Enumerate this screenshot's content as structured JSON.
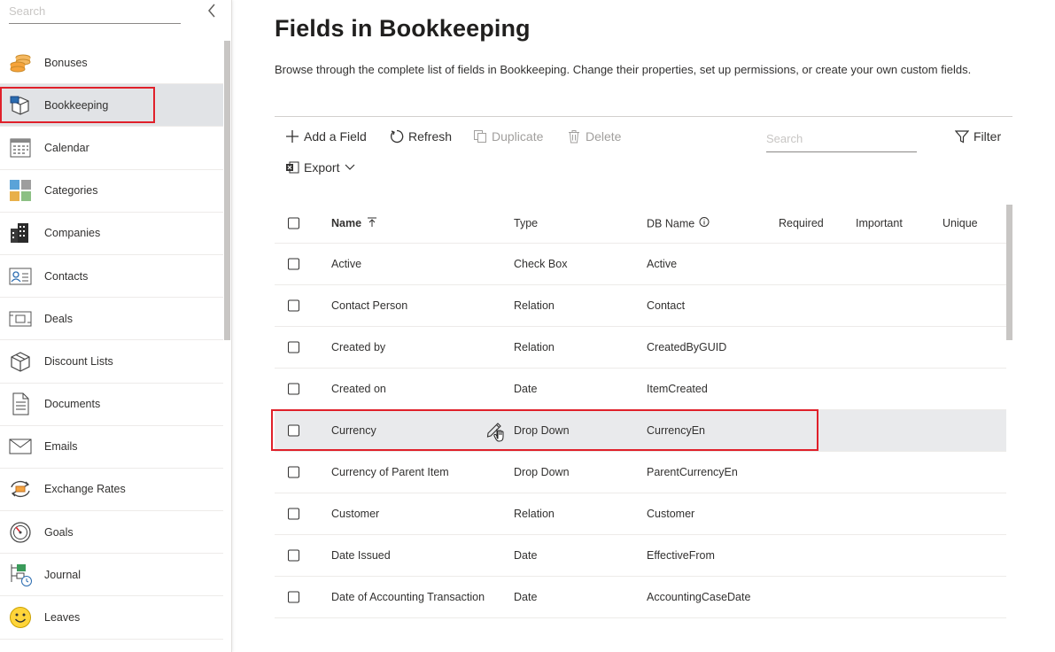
{
  "sidebar": {
    "search_placeholder": "Search",
    "items": [
      {
        "label": "Bonuses",
        "icon": "coins-icon"
      },
      {
        "label": "Bookkeeping",
        "icon": "bookkeeping-box-icon",
        "active": true
      },
      {
        "label": "Calendar",
        "icon": "calendar-icon"
      },
      {
        "label": "Categories",
        "icon": "categories-grid-icon"
      },
      {
        "label": "Companies",
        "icon": "building-icon"
      },
      {
        "label": "Contacts",
        "icon": "contact-card-icon"
      },
      {
        "label": "Deals",
        "icon": "deal-icon"
      },
      {
        "label": "Discount Lists",
        "icon": "discount-box-icon"
      },
      {
        "label": "Documents",
        "icon": "document-icon"
      },
      {
        "label": "Emails",
        "icon": "envelope-icon"
      },
      {
        "label": "Exchange Rates",
        "icon": "exchange-icon"
      },
      {
        "label": "Goals",
        "icon": "gauge-icon"
      },
      {
        "label": "Journal",
        "icon": "journal-icon"
      },
      {
        "label": "Leaves",
        "icon": "smiley-icon"
      }
    ]
  },
  "main": {
    "title": "Fields in Bookkeeping",
    "description": "Browse through the complete list of fields in Bookkeeping. Change their properties, set up permissions, or create your own custom fields.",
    "toolbar": {
      "add": "Add a Field",
      "refresh": "Refresh",
      "duplicate": "Duplicate",
      "delete": "Delete",
      "search_placeholder": "Search",
      "filter": "Filter",
      "export": "Export"
    },
    "table": {
      "columns": {
        "name": "Name",
        "type": "Type",
        "db_name": "DB Name",
        "required": "Required",
        "important": "Important",
        "unique": "Unique"
      },
      "rows": [
        {
          "name": "Active",
          "type": "Check Box",
          "db": "Active"
        },
        {
          "name": "Contact Person",
          "type": "Relation",
          "db": "Contact"
        },
        {
          "name": "Created by",
          "type": "Relation",
          "db": "CreatedByGUID"
        },
        {
          "name": "Created on",
          "type": "Date",
          "db": "ItemCreated"
        },
        {
          "name": "Currency",
          "type": "Drop Down",
          "db": "CurrencyEn"
        },
        {
          "name": "Currency of Parent Item",
          "type": "Drop Down",
          "db": "ParentCurrencyEn"
        },
        {
          "name": "Customer",
          "type": "Relation",
          "db": "Customer"
        },
        {
          "name": "Date Issued",
          "type": "Date",
          "db": "EffectiveFrom"
        },
        {
          "name": "Date of Accounting Transaction",
          "type": "Date",
          "db": "AccountingCaseDate"
        }
      ]
    }
  },
  "colors": {
    "highlight": "#e0202a",
    "active_bg": "#e1e3e6",
    "hover_bg": "#e9eaec"
  }
}
